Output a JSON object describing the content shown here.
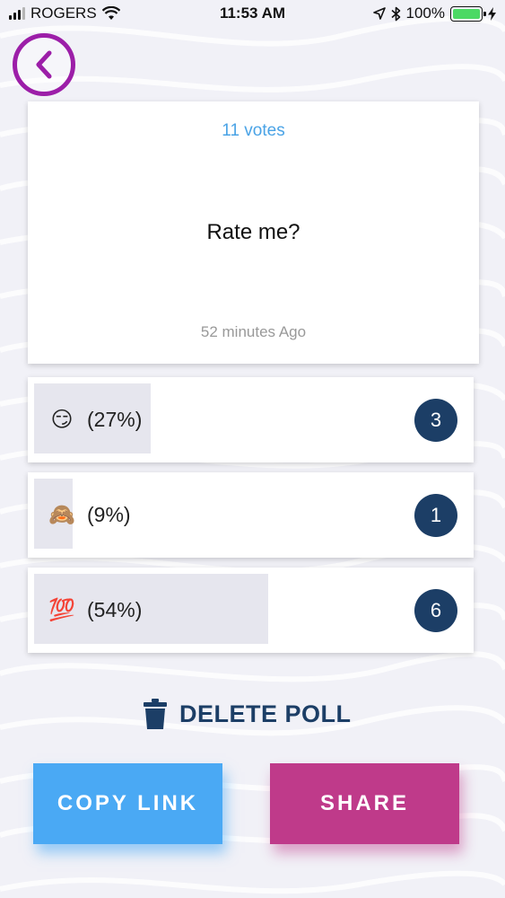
{
  "status_bar": {
    "carrier": "ROGERS",
    "time": "11:53 AM",
    "battery": "100%"
  },
  "poll": {
    "votes": "11 votes",
    "question": "Rate me?",
    "timestamp": "52 minutes Ago"
  },
  "options": [
    {
      "emoji": "😏",
      "percent_label": "(27%)",
      "count": "3",
      "fill_fraction": 0.27
    },
    {
      "emoji": "🙈",
      "percent_label": "(9%)",
      "count": "1",
      "fill_fraction": 0.09
    },
    {
      "emoji": "💯",
      "percent_label": "(54%)",
      "count": "6",
      "fill_fraction": 0.54
    }
  ],
  "actions": {
    "delete_label": "DELETE POLL",
    "copy_link_label": "COPY LINK",
    "share_label": "SHARE"
  },
  "colors": {
    "accent_purple": "#9c1ea8",
    "navy": "#1c3e66",
    "vote_blue": "#4aa3e6",
    "copy_blue": "#4aa9f4",
    "share_magenta": "#bf3a8a"
  },
  "icons": {
    "back": "chevron-left-icon",
    "delete": "trash-icon"
  }
}
